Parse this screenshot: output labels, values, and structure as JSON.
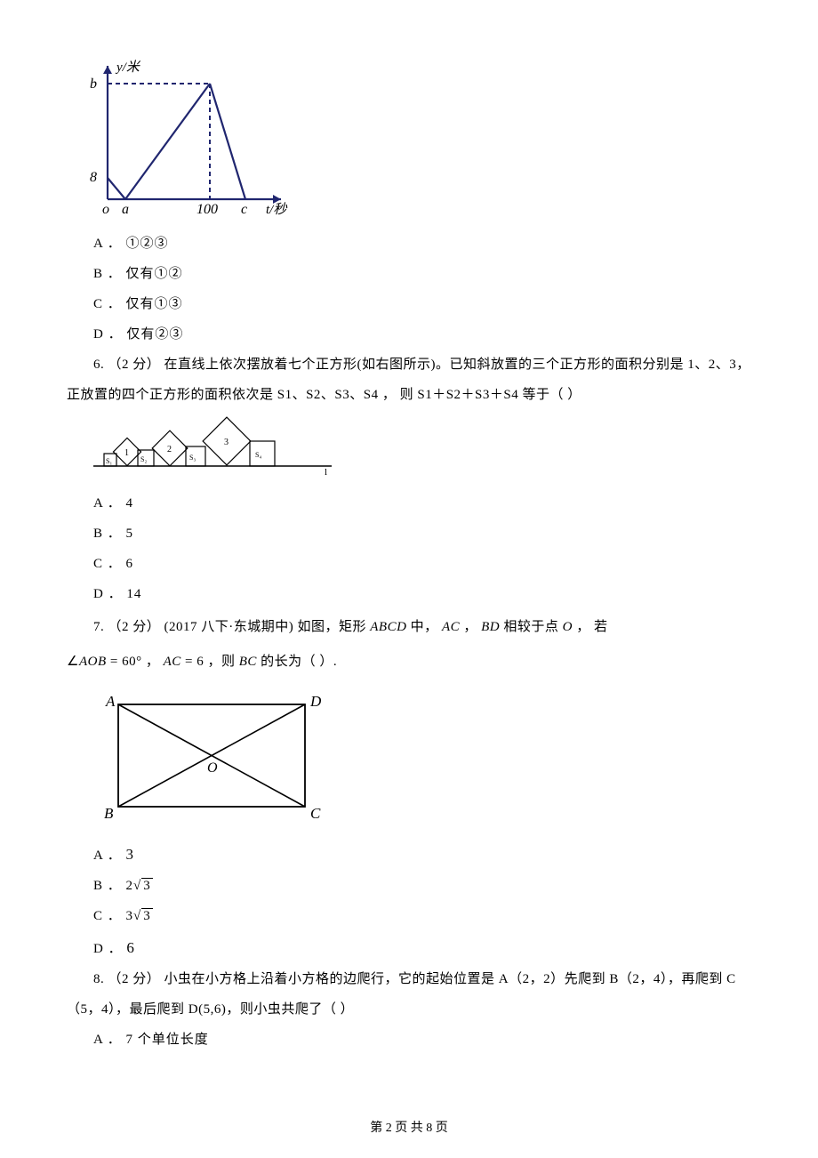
{
  "fig5": {
    "ylabel": "y/米",
    "xlabel": "t/秒",
    "axis": {
      "b": "b",
      "eight": "8",
      "o": "o",
      "a": "a",
      "hundred": "100",
      "c": "c"
    }
  },
  "q5": {
    "optA": "A ． ①②③",
    "optB": "B ． 仅有①②",
    "optC": "C ． 仅有①③",
    "optD": "D ． 仅有②③"
  },
  "q6": {
    "stem_l1": "6. （2 分）  在直线上依次摆放着七个正方形(如右图所示)。已知斜放置的三个正方形的面积分别是 1、2、3，",
    "stem_l2": "正放置的四个正方形的面积依次是 S1、S2、S3、S4 ，  则 S1＋S2＋S3＋S4 等于（    ）",
    "fig": {
      "s1": "S₁",
      "d1": "1",
      "s2": "S₂",
      "d2": "2",
      "s3": "S₃",
      "d3": "3",
      "s4": "S₄",
      "l": "l"
    },
    "optA": "A ． 4",
    "optB": "B ． 5",
    "optC": "C ． 6",
    "optD": "D ． 14"
  },
  "q7": {
    "stem_prefix": "7. （2 分）  (2017 八下·东城期中)  如图，矩形 ",
    "ABCD": "ABCD",
    "mid1": " 中，  ",
    "AC": "AC",
    "mid2": " ， ",
    "BD": "BD",
    "mid3": " 相较于点 ",
    "O": "O",
    "mid4": " ， 若",
    "angle_expr_pre": "∠",
    "AOB": "AOB",
    "eq60": " = 60° ，  ",
    "AC2": "AC",
    "eq6": " = 6 ，则 ",
    "BC": "BC",
    "tail": " 的长为（    ）.",
    "fig": {
      "A": "A",
      "B": "B",
      "C": "C",
      "D": "D",
      "O": "O"
    },
    "optA": "A ． ",
    "valA": "3",
    "optB": "B ． ",
    "valB_coef": "2",
    "valB_rad": "3",
    "optC": "C ． ",
    "valC_coef": "3",
    "valC_rad": "3",
    "optD": "D ． ",
    "valD": "6"
  },
  "q8": {
    "stem_l1": "8. （2 分）  小虫在小方格上沿着小方格的边爬行，它的起始位置是 A（2，2）先爬到 B（2，4），再爬到 C",
    "stem_l2": "（5，4），最后爬到 D(5,6)，则小虫共爬了（    ）",
    "optA": "A ． 7 个单位长度"
  },
  "footer": "第 2 页 共 8 页"
}
